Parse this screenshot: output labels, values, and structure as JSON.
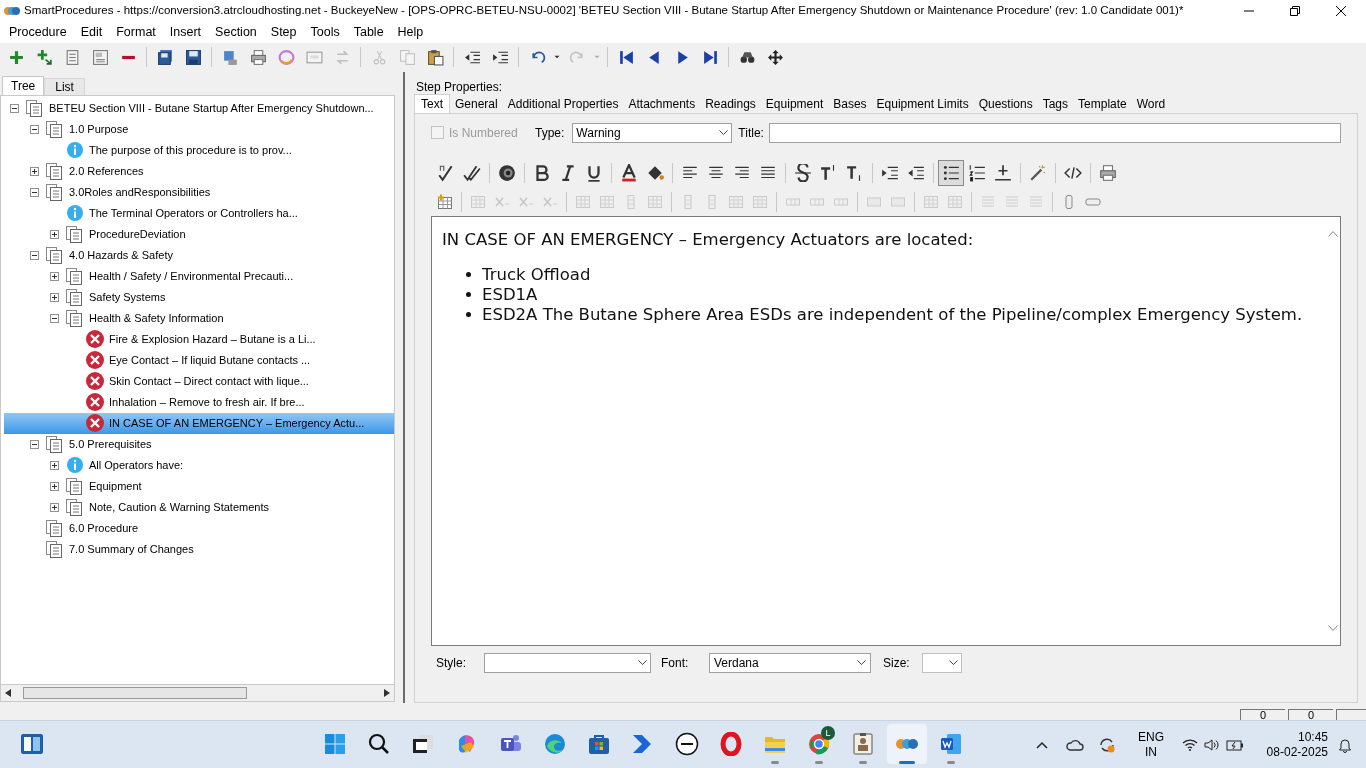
{
  "window": {
    "title": "SmartProcedures - https://conversion3.atrcloudhosting.net - BuckeyeNew - [OPS-OPRC-BETEU-NSU-0002] 'BETEU Section VIII - Butane Startup After Emergency Shutdown or Maintenance Procedure' (rev: 1.0 Candidate 001)*"
  },
  "menu": [
    "Procedure",
    "Edit",
    "Format",
    "Insert",
    "Section",
    "Step",
    "Tools",
    "Table",
    "Help"
  ],
  "toolbar": [
    [
      {
        "kind": "plus",
        "disabled": false
      },
      {
        "kind": "plus-arrow",
        "disabled": false
      },
      {
        "kind": "document",
        "disabled": false
      },
      {
        "kind": "form",
        "disabled": false
      },
      {
        "kind": "minus",
        "disabled": false
      }
    ],
    [
      {
        "kind": "floppy-stack",
        "disabled": false
      },
      {
        "kind": "floppy",
        "disabled": false
      }
    ],
    [
      {
        "kind": "monitor",
        "disabled": false
      },
      {
        "kind": "printer",
        "disabled": false
      },
      {
        "kind": "ring",
        "disabled": false
      },
      {
        "kind": "panel",
        "disabled": false
      },
      {
        "kind": "arrows",
        "disabled": true
      }
    ],
    [
      {
        "kind": "scissors",
        "disabled": true
      },
      {
        "kind": "copy",
        "disabled": true
      },
      {
        "kind": "clipboard",
        "disabled": false
      }
    ],
    [
      {
        "kind": "outdent",
        "disabled": false
      },
      {
        "kind": "indent",
        "disabled": false
      }
    ],
    [
      {
        "kind": "undo",
        "disabled": false
      },
      {
        "kind": "caret",
        "disabled": false
      },
      {
        "kind": "redo",
        "disabled": true
      },
      {
        "kind": "caret",
        "disabled": true
      }
    ],
    [
      {
        "kind": "skip-first",
        "disabled": false
      },
      {
        "kind": "prev",
        "disabled": false
      },
      {
        "kind": "next",
        "disabled": false
      },
      {
        "kind": "skip-last",
        "disabled": false
      }
    ],
    [
      {
        "kind": "binoculars",
        "disabled": false
      },
      {
        "kind": "move",
        "disabled": false
      }
    ]
  ],
  "left_tabs": [
    {
      "label": "Tree",
      "selected": true
    },
    {
      "label": "List",
      "selected": false
    }
  ],
  "tree": [
    {
      "label": "BETEU Section VIII - Butane Startup After Emergency Shutdown...",
      "kind": "doc",
      "expanded": true,
      "selected": false,
      "children": [
        {
          "label": "1.0 Purpose",
          "kind": "doc",
          "expanded": true,
          "selected": false,
          "children": [
            {
              "label": "The purpose of this procedure is to prov...",
              "kind": "info",
              "selected": false
            }
          ]
        },
        {
          "label": "2.0 References",
          "kind": "doc",
          "expanded": false,
          "selected": false
        },
        {
          "label": "3.0Roles andResponsibilities",
          "kind": "doc",
          "expanded": true,
          "selected": false,
          "children": [
            {
              "label": "The Terminal Operators or Controllers ha...",
              "kind": "info",
              "selected": false
            },
            {
              "label": "ProcedureDeviation",
              "kind": "doc",
              "expanded": false,
              "selected": false
            }
          ]
        },
        {
          "label": "4.0 Hazards & Safety",
          "kind": "doc",
          "expanded": true,
          "selected": false,
          "children": [
            {
              "label": "Health / Safety / Environmental Precauti...",
              "kind": "doc",
              "expanded": false,
              "selected": false
            },
            {
              "label": "Safety Systems",
              "kind": "doc",
              "expanded": false,
              "selected": false
            },
            {
              "label": "Health & Safety Information",
              "kind": "doc",
              "expanded": true,
              "selected": false,
              "children": [
                {
                  "label": "Fire & Explosion Hazard – Butane is a Li...",
                  "kind": "warning",
                  "selected": false
                },
                {
                  "label": "Eye Contact – If liquid Butane contacts ...",
                  "kind": "warning",
                  "selected": false
                },
                {
                  "label": "Skin Contact – Direct contact with lique...",
                  "kind": "warning",
                  "selected": false
                },
                {
                  "label": "Inhalation – Remove to fresh air. If bre...",
                  "kind": "warning",
                  "selected": false
                },
                {
                  "label": "IN CASE OF AN EMERGENCY – Emergency Actu...",
                  "kind": "warning",
                  "selected": true
                }
              ]
            }
          ]
        },
        {
          "label": "5.0 Prerequisites",
          "kind": "doc",
          "expanded": true,
          "selected": false,
          "children": [
            {
              "label": "All Operators have:",
              "kind": "info",
              "expanded": false,
              "selected": false
            },
            {
              "label": "Equipment",
              "kind": "doc",
              "expanded": false,
              "selected": false
            },
            {
              "label": "Note, Caution & Warning Statements",
              "kind": "doc",
              "expanded": false,
              "selected": false
            }
          ]
        },
        {
          "label": "6.0 Procedure",
          "kind": "doc",
          "selected": false
        },
        {
          "label": "7.0 Summary of Changes",
          "kind": "doc",
          "selected": false
        }
      ]
    }
  ],
  "step_properties": {
    "label": "Step Properties:",
    "tabs": [
      {
        "label": "Text",
        "selected": true
      },
      {
        "label": "General",
        "selected": false
      },
      {
        "label": "Additional Properties",
        "selected": false
      },
      {
        "label": "Attachments",
        "selected": false
      },
      {
        "label": "Readings",
        "selected": false
      },
      {
        "label": "Equipment",
        "selected": false
      },
      {
        "label": "Bases",
        "selected": false
      },
      {
        "label": "Equipment Limits",
        "selected": false
      },
      {
        "label": "Questions",
        "selected": false
      },
      {
        "label": "Tags",
        "selected": false
      },
      {
        "label": "Template",
        "selected": false
      },
      {
        "label": "Word",
        "selected": false
      }
    ],
    "is_numbered": {
      "label": "Is Numbered",
      "checked": false,
      "disabled": true
    },
    "type": {
      "label": "Type:",
      "value": "Warning"
    },
    "title": {
      "label": "Title:"
    },
    "editor_toolbar": [
      [
        {
          "kind": "spell",
          "on": false
        },
        {
          "kind": "spell-all",
          "on": false
        }
      ],
      [
        {
          "kind": "speaker",
          "on": false
        }
      ],
      [
        {
          "kind": "bold",
          "on": false
        },
        {
          "kind": "italic",
          "on": false
        },
        {
          "kind": "underline",
          "on": false
        }
      ],
      [
        {
          "kind": "font-color",
          "on": false
        },
        {
          "kind": "fill",
          "on": false
        }
      ],
      [
        {
          "kind": "align-left",
          "on": false
        },
        {
          "kind": "align-center",
          "on": false
        },
        {
          "kind": "align-right",
          "on": false
        },
        {
          "kind": "justify",
          "on": false
        }
      ],
      [
        {
          "kind": "strike",
          "on": false
        },
        {
          "kind": "superscript",
          "on": false
        },
        {
          "kind": "subscript",
          "on": false
        }
      ],
      [
        {
          "kind": "indent",
          "on": false
        },
        {
          "kind": "outdent",
          "on": false
        }
      ],
      [
        {
          "kind": "bullets",
          "on": true
        },
        {
          "kind": "numbering",
          "on": false
        },
        {
          "kind": "rule",
          "on": false
        }
      ],
      [
        {
          "kind": "wand",
          "on": false
        }
      ],
      [
        {
          "kind": "code",
          "on": false
        }
      ],
      [
        {
          "kind": "printer",
          "on": false
        }
      ]
    ],
    "table_toolbar": [
      [
        {
          "kind": "table",
          "disabled": false
        }
      ],
      [
        {
          "kind": "grid",
          "disabled": true
        },
        {
          "kind": "cross",
          "disabled": true
        },
        {
          "kind": "cross",
          "disabled": true
        },
        {
          "kind": "cross",
          "disabled": true
        }
      ],
      [
        {
          "kind": "grid",
          "disabled": true
        },
        {
          "kind": "grid",
          "disabled": true
        },
        {
          "kind": "column",
          "disabled": true
        },
        {
          "kind": "grid",
          "disabled": true
        }
      ],
      [
        {
          "kind": "column",
          "disabled": true
        },
        {
          "kind": "column",
          "disabled": true
        },
        {
          "kind": "grid",
          "disabled": true
        },
        {
          "kind": "grid",
          "disabled": true
        }
      ],
      [
        {
          "kind": "row",
          "disabled": true
        },
        {
          "kind": "row",
          "disabled": true
        },
        {
          "kind": "row",
          "disabled": true
        }
      ],
      [
        {
          "kind": "merge",
          "disabled": true
        },
        {
          "kind": "merge",
          "disabled": true
        }
      ],
      [
        {
          "kind": "grid",
          "disabled": true
        },
        {
          "kind": "grid",
          "disabled": true
        }
      ],
      [
        {
          "kind": "lines",
          "disabled": true
        },
        {
          "kind": "lines",
          "disabled": true
        },
        {
          "kind": "lines",
          "disabled": true
        }
      ],
      [
        {
          "kind": "cylinder",
          "disabled": false
        },
        {
          "kind": "pill",
          "disabled": false
        }
      ]
    ],
    "content": {
      "heading": "IN CASE OF AN EMERGENCY – Emergency Actuators are located:",
      "bullets": [
        "Truck Offload",
        "ESD1A",
        "ESD2A The Butane Sphere Area ESDs are independent of the Pipeline/complex Emergency System."
      ]
    },
    "style": {
      "label": "Style:"
    },
    "font": {
      "label": "Font:",
      "value": "Verdana"
    },
    "size": {
      "label": "Size:"
    }
  },
  "status_bar": [
    "0",
    "0"
  ],
  "taskbar": {
    "apps": [
      {
        "kind": "start",
        "open": false,
        "active": false
      },
      {
        "kind": "search",
        "open": false,
        "active": false
      },
      {
        "kind": "taskview",
        "open": false,
        "active": false
      },
      {
        "kind": "swirl",
        "open": false,
        "active": false
      },
      {
        "kind": "people",
        "open": false,
        "active": false
      },
      {
        "kind": "wave",
        "open": false,
        "active": false
      },
      {
        "kind": "bag",
        "open": false,
        "active": false
      },
      {
        "kind": "chevron",
        "open": false,
        "active": false
      },
      {
        "kind": "disc",
        "open": false,
        "active": false
      },
      {
        "kind": "ring",
        "open": false,
        "active": false
      },
      {
        "kind": "folder",
        "open": true,
        "active": false
      },
      {
        "kind": "globe",
        "open": true,
        "active": false,
        "badge": "L"
      },
      {
        "kind": "id-card",
        "open": true,
        "active": false
      },
      {
        "kind": "dots",
        "open": true,
        "active": true
      },
      {
        "kind": "doc",
        "open": true,
        "active": false
      }
    ],
    "language": "ENG",
    "region": "IN",
    "time": "10:45",
    "date": "08-02-2025"
  }
}
